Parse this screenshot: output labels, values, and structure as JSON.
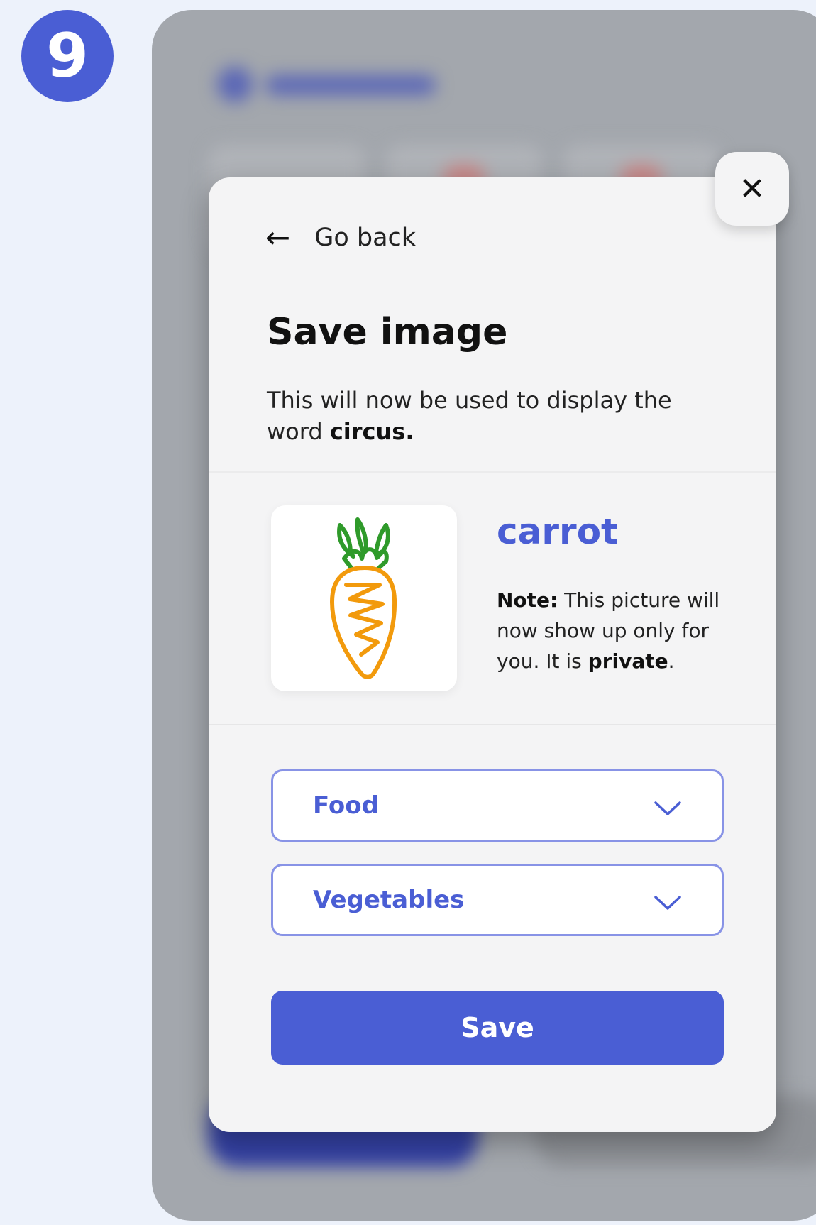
{
  "step_badge": "9",
  "modal": {
    "back_label": "Go back",
    "title": "Save image",
    "description_prefix": "This will now be used to display the word ",
    "description_word": "circus.",
    "word": "carrot",
    "note_label": "Note:",
    "note_text": " This picture will now show up only for you. It is ",
    "note_emphasis": "private",
    "note_end": ".",
    "category_value": "Food",
    "subcategory_value": "Vegetables",
    "save_label": "Save"
  },
  "icons": {
    "close": "close-icon",
    "back": "arrow-left-icon",
    "dropdown": "chevron-down-icon",
    "preview": "carrot-drawing"
  },
  "colors": {
    "accent": "#4a5ed4",
    "background": "#edf2fb",
    "modal_bg": "#f4f4f5",
    "dropdown_border": "#8893e6",
    "carrot_orange": "#f29a0c",
    "carrot_green": "#2f9a2a"
  }
}
